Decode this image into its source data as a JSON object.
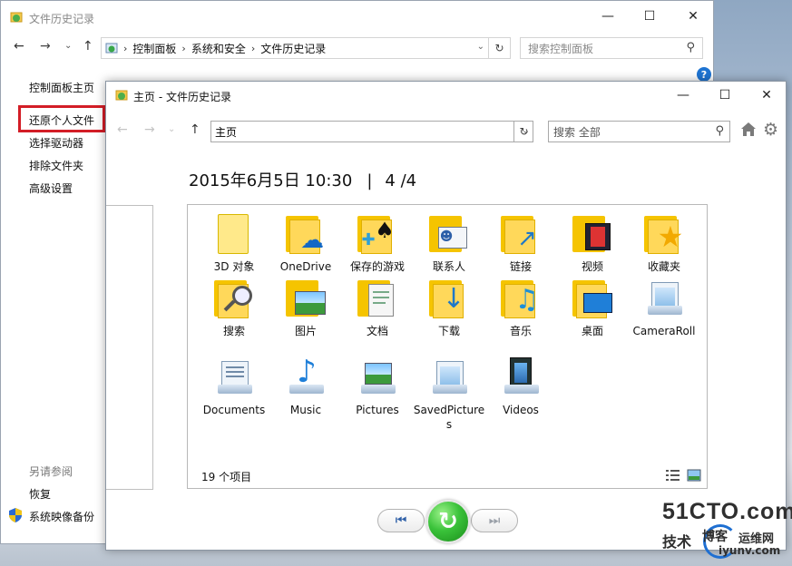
{
  "bg_window": {
    "title": "文件历史记录",
    "breadcrumbs": [
      "控制面板",
      "系统和安全",
      "文件历史记录"
    ],
    "search_placeholder": "搜索控制面板",
    "help_label": "?",
    "left_nav": [
      "控制面板主页",
      "还原个人文件",
      "选择驱动器",
      "排除文件夹",
      "高级设置"
    ],
    "see_also_header": "另请参阅",
    "see_also": [
      "恢复",
      "系统映像备份"
    ]
  },
  "fg_window": {
    "title": "主页 - 文件历史记录",
    "address": "主页",
    "search_placeholder": "搜索 全部",
    "date_label": "2015年6月5日 10:30",
    "version_label": "4 /4",
    "item_count": "19 个项目",
    "items": [
      {
        "label": "3D 对象",
        "icon": "3d-objects-folder-icon"
      },
      {
        "label": "OneDrive",
        "icon": "onedrive-folder-icon"
      },
      {
        "label": "保存的游戏",
        "icon": "saved-games-folder-icon"
      },
      {
        "label": "联系人",
        "icon": "contacts-folder-icon"
      },
      {
        "label": "链接",
        "icon": "links-folder-icon"
      },
      {
        "label": "视频",
        "icon": "videos-folder-icon"
      },
      {
        "label": "收藏夹",
        "icon": "favorites-folder-icon"
      },
      {
        "label": "搜索",
        "icon": "searches-folder-icon"
      },
      {
        "label": "图片",
        "icon": "pictures-folder-icon"
      },
      {
        "label": "文档",
        "icon": "documents-folder-icon"
      },
      {
        "label": "下载",
        "icon": "downloads-folder-icon"
      },
      {
        "label": "音乐",
        "icon": "music-folder-icon"
      },
      {
        "label": "桌面",
        "icon": "desktop-folder-icon"
      },
      {
        "label": "CameraRoll",
        "icon": "cameraroll-library-icon"
      },
      {
        "label": "Documents",
        "icon": "documents-library-icon"
      },
      {
        "label": "Music",
        "icon": "music-library-icon"
      },
      {
        "label": "Pictures",
        "icon": "pictures-library-icon"
      },
      {
        "label": "SavedPictures",
        "icon": "savedpictures-library-icon"
      },
      {
        "label": "Videos",
        "icon": "videos-library-icon"
      }
    ]
  },
  "watermark": {
    "brand": "51CTO.com",
    "line2a": "技术",
    "line2b": "博客",
    "line2c": "运维网",
    "line3": "iyunv.com"
  },
  "colors": {
    "highlight_border": "#d31d26",
    "restore_button": "#3ac23a",
    "help_icon": "#1e74d2",
    "folder_yellow": "#ffd85a"
  }
}
